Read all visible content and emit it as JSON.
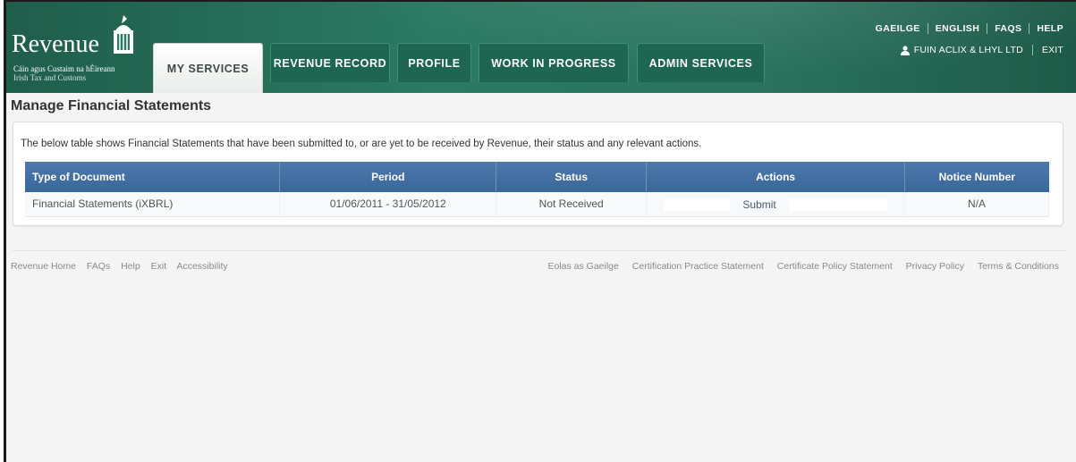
{
  "brand": {
    "name": "Revenue",
    "subtitle_irish": "Cáin agus Custaim na hÉireann",
    "subtitle_english": "Irish Tax and Customs"
  },
  "nav": {
    "tabs": [
      {
        "label": "MY SERVICES",
        "active": true
      },
      {
        "label": "REVENUE RECORD",
        "active": false
      },
      {
        "label": "PROFILE",
        "active": false
      },
      {
        "label": "WORK IN PROGRESS",
        "active": false
      },
      {
        "label": "ADMIN SERVICES",
        "active": false
      }
    ]
  },
  "utility": {
    "links": [
      "GAEILGE",
      "ENGLISH",
      "FAQS",
      "HELP"
    ],
    "user_name": "FUIN ACLIX & LHYL LTD",
    "exit_label": "EXIT"
  },
  "page": {
    "title": "Manage Financial Statements",
    "intro": "The below table shows Financial Statements that have been submitted to, or are yet to be received by Revenue, their status and any relevant actions."
  },
  "table": {
    "headers": [
      "Type of Document",
      "Period",
      "Status",
      "Actions",
      "Notice Number"
    ],
    "rows": [
      {
        "type": "Financial Statements (iXBRL)",
        "period": "01/06/2011 - 31/05/2012",
        "status": "Not Received",
        "action": "Submit",
        "notice": "N/A"
      }
    ]
  },
  "footer": {
    "left": [
      "Revenue Home",
      "FAQs",
      "Help",
      "Exit",
      "Accessibility"
    ],
    "right": [
      "Eolas as Gaeilge",
      "Certification Practice Statement",
      "Certificate Policy Statement",
      "Privacy Policy",
      "Terms & Conditions"
    ]
  },
  "colors": {
    "header_green": "#2b7a62",
    "table_header_blue": "#4371a6"
  }
}
